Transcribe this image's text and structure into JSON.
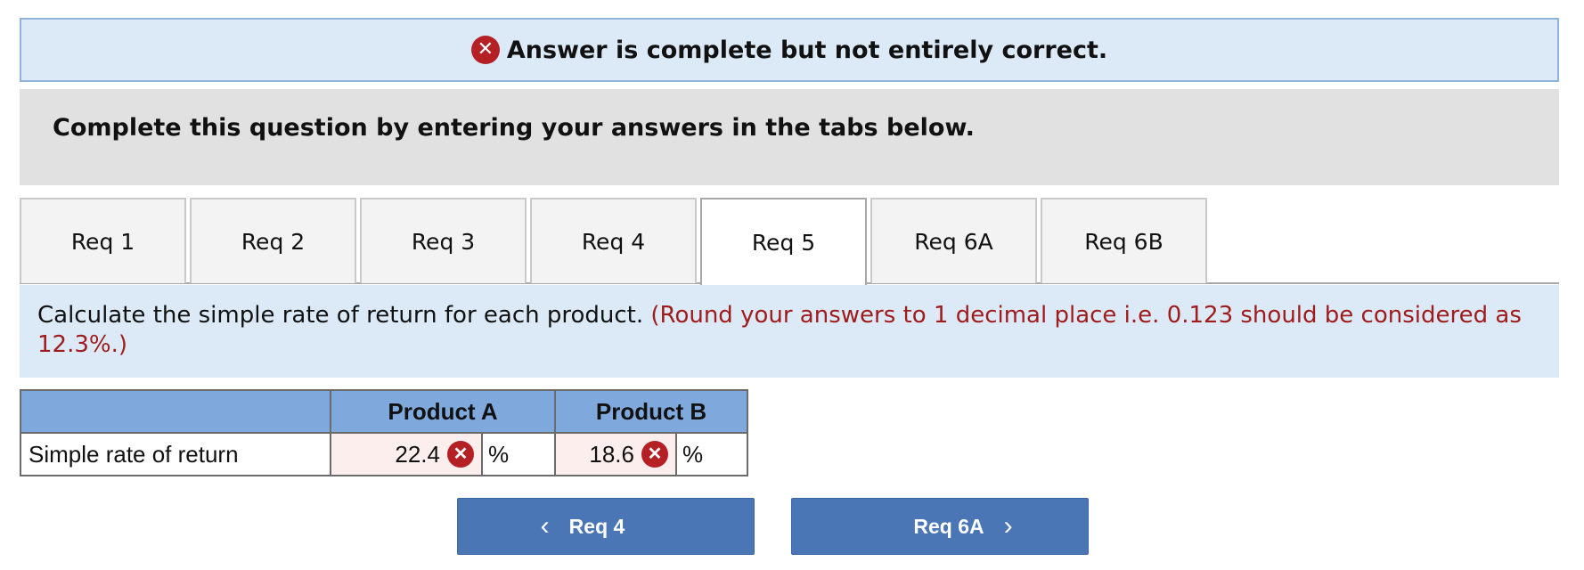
{
  "banner": {
    "icon": "x-circle-icon",
    "message": "Answer is complete but not entirely correct."
  },
  "instruction": "Complete this question by entering your answers in the tabs below.",
  "tabs": [
    {
      "label": "Req 1",
      "active": false
    },
    {
      "label": "Req 2",
      "active": false
    },
    {
      "label": "Req 3",
      "active": false
    },
    {
      "label": "Req 4",
      "active": false
    },
    {
      "label": "Req 5",
      "active": true
    },
    {
      "label": "Req 6A",
      "active": false
    },
    {
      "label": "Req 6B",
      "active": false
    }
  ],
  "question": {
    "text": "Calculate the simple rate of return for each product.",
    "note": "(Round your answers to 1 decimal place i.e. 0.123 should be considered as 12.3%.)"
  },
  "table": {
    "headers": [
      "",
      "Product A",
      "Product B"
    ],
    "row": {
      "label": "Simple rate of return",
      "product_a": "22.4",
      "product_b": "18.6",
      "unit": "%"
    }
  },
  "nav": {
    "prev_label": "Req 4",
    "next_label": "Req 6A"
  },
  "colors": {
    "error": "#b52025",
    "banner_bg": "#dceaf8",
    "button": "#4a76b6",
    "header": "#7fa8dc",
    "note": "#a01c1c"
  }
}
